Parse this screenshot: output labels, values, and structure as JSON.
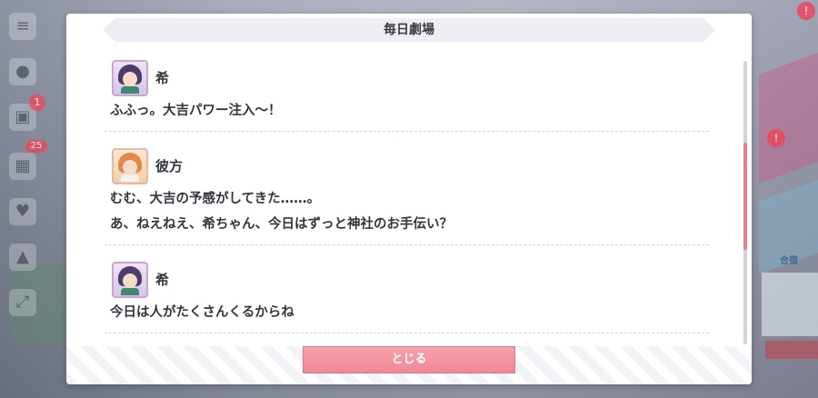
{
  "dialog": {
    "title": "毎日劇場",
    "close_label": "とじる"
  },
  "entries": [
    {
      "speaker": "希",
      "lines": [
        "ふふっ。大吉パワー注入〜！"
      ]
    },
    {
      "speaker": "彼方",
      "lines": [
        "むむ、大吉の予感がしてきた……。",
        "あ、ねえねえ、希ちゃん、今日はずっと神社のお手伝い？"
      ]
    },
    {
      "speaker": "希",
      "lines": [
        "今日は人がたくさんくるからね"
      ]
    }
  ],
  "background": {
    "left_badge_1": "1",
    "left_badge_2": "25",
    "right_badge_1": "!",
    "right_badge_2": "!",
    "right_label": "合宿"
  },
  "icons": {
    "menu": "menu-icon",
    "chat": "chat-icon",
    "bag": "bag-icon",
    "gift": "gift-icon",
    "heart": "heart-icon",
    "shirt": "shirt-icon",
    "expand": "expand-icon"
  },
  "colors": {
    "accent": "#ee8894",
    "scroll_thumb": "#ee7c8a",
    "text": "#34343e"
  }
}
